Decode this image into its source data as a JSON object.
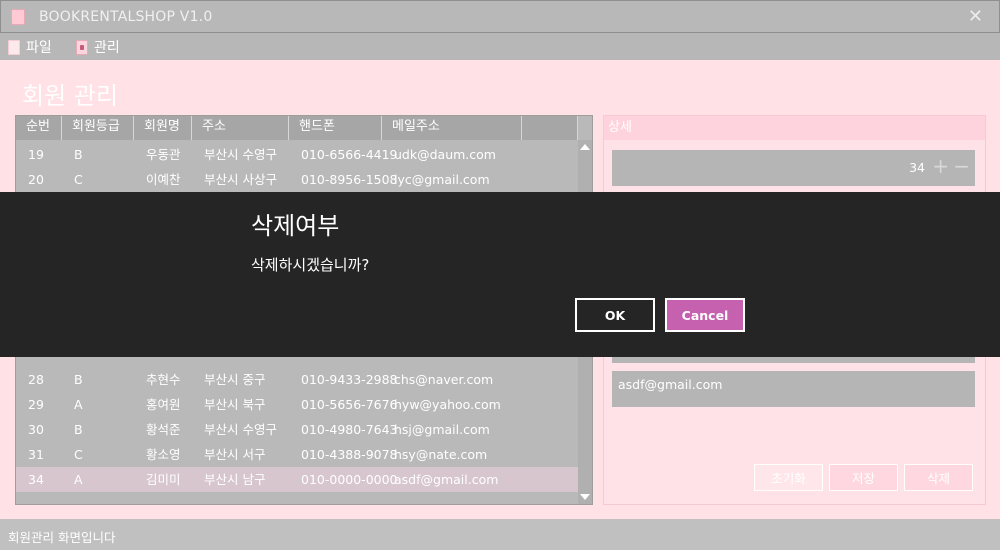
{
  "window": {
    "title": "BOOKRENTALSHOP V1.0",
    "close_symbol": "✕"
  },
  "menu": {
    "items": [
      {
        "label": "파일",
        "icon": "file-icon"
      },
      {
        "label": "관리",
        "icon": "admin-icon"
      }
    ]
  },
  "page": {
    "title": "회원 관리"
  },
  "grid": {
    "columns": [
      "순번",
      "회원등급",
      "회원명",
      "주소",
      "핸드폰",
      "메일주소",
      ""
    ],
    "rows": [
      {
        "id": "19",
        "grade": "B",
        "name": "우동관",
        "addr": "부산시 수영구",
        "phone": "010-6566-4419",
        "email": "udk@daum.com"
      },
      {
        "id": "20",
        "grade": "C",
        "name": "이예찬",
        "addr": "부산시 사상구",
        "phone": "010-8956-1508",
        "email": "lyc@gmail.com"
      },
      {
        "id": "28",
        "grade": "B",
        "name": "추현수",
        "addr": "부산시 중구",
        "phone": "010-9433-2988",
        "email": "chs@naver.com"
      },
      {
        "id": "29",
        "grade": "A",
        "name": "홍여원",
        "addr": "부산시 북구",
        "phone": "010-5656-7676",
        "email": "hyw@yahoo.com"
      },
      {
        "id": "30",
        "grade": "B",
        "name": "황석준",
        "addr": "부산시 수영구",
        "phone": "010-4980-7643",
        "email": "hsj@gmail.com"
      },
      {
        "id": "31",
        "grade": "C",
        "name": "황소영",
        "addr": "부산시 서구",
        "phone": "010-4388-9078",
        "email": "hsy@nate.com"
      },
      {
        "id": "34",
        "grade": "A",
        "name": "김미미",
        "addr": "부산시 남구",
        "phone": "010-0000-0000",
        "email": "asdf@gmail.com",
        "selected": true
      }
    ]
  },
  "detail": {
    "header": "상세",
    "id_value": "34",
    "plus_symbol": "+",
    "minus_symbol": "−",
    "email_value": "asdf@gmail.com",
    "reset_label": "초기화",
    "save_label": "저장",
    "delete_label": "삭제"
  },
  "status": {
    "text": "회원관리 화면입니다"
  },
  "dialog": {
    "title": "삭제여부",
    "message": "삭제하시겠습니까?",
    "ok_label": "OK",
    "cancel_label": "Cancel"
  },
  "colors": {
    "accent_pink": "#c661b0",
    "dialog_bg": "#252525",
    "content_bg": "#ffe1e6"
  }
}
